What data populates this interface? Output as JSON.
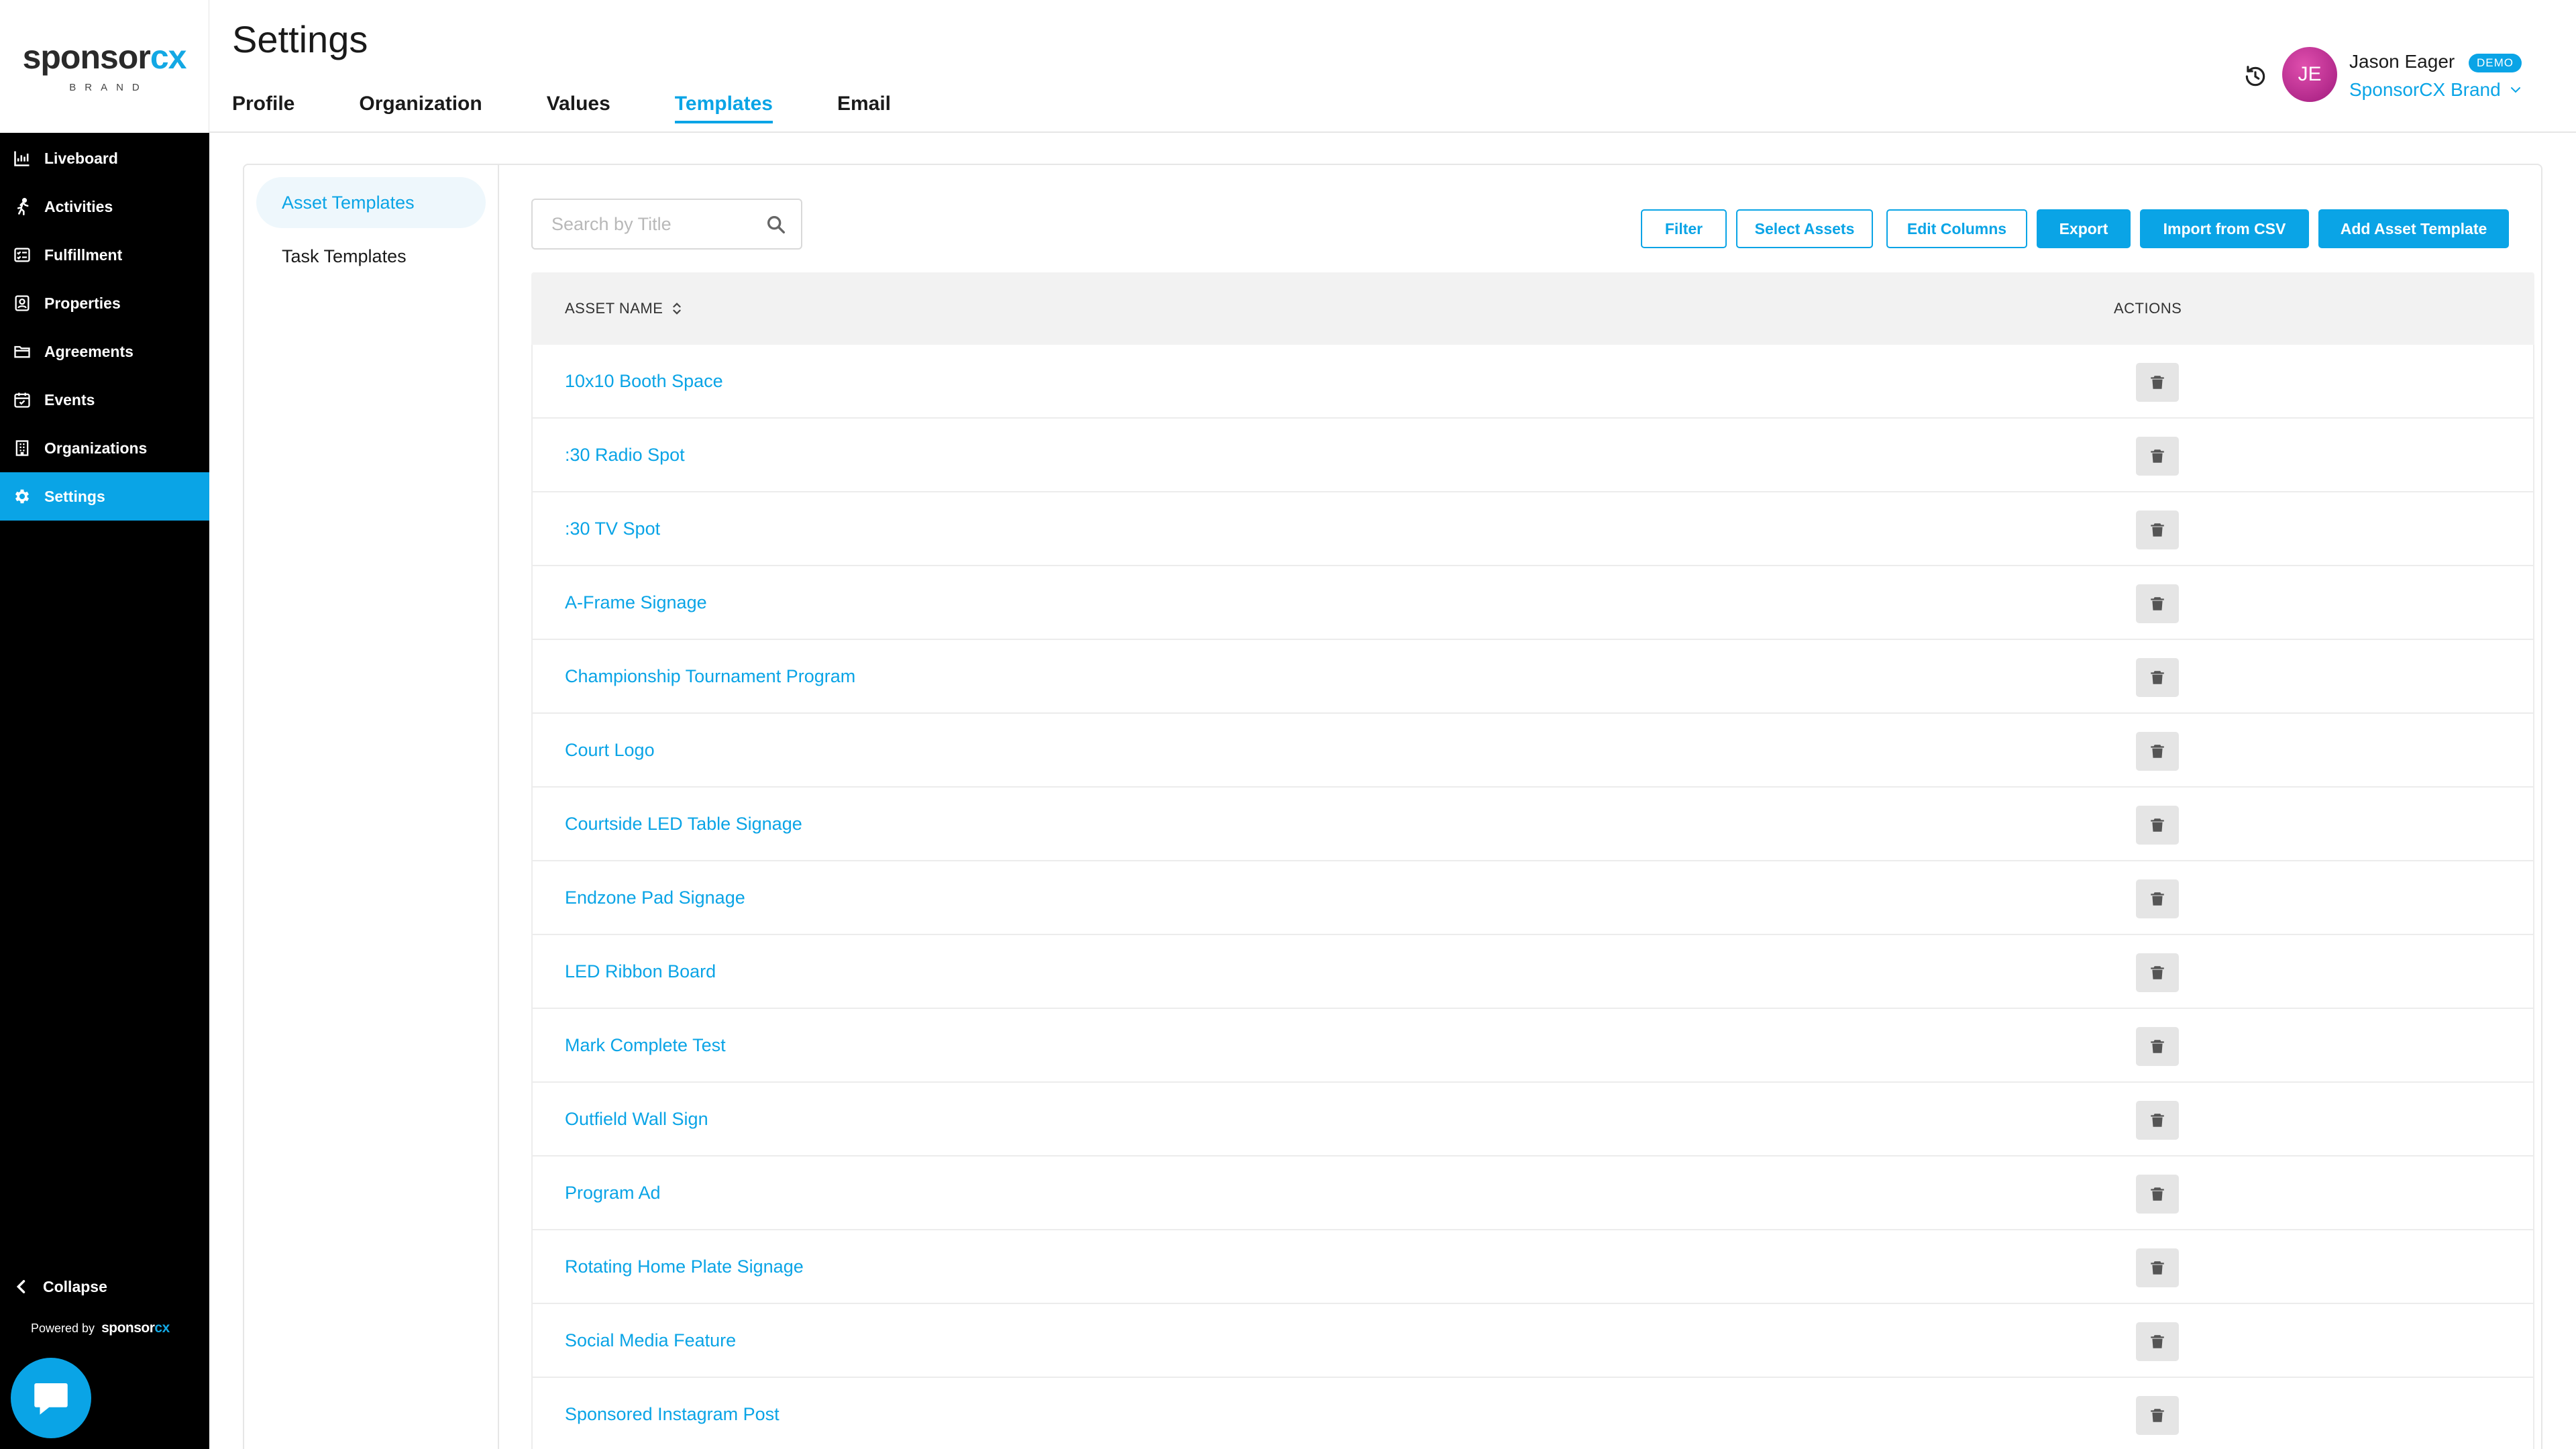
{
  "app": {
    "logo_main": "sponsor",
    "logo_accent": "cx",
    "logo_sub": "BRAND"
  },
  "sidebar": {
    "items": [
      {
        "label": "Liveboard",
        "icon": "chart-icon"
      },
      {
        "label": "Activities",
        "icon": "running-icon"
      },
      {
        "label": "Fulfillment",
        "icon": "checklist-icon"
      },
      {
        "label": "Properties",
        "icon": "id-card-icon"
      },
      {
        "label": "Agreements",
        "icon": "folder-icon"
      },
      {
        "label": "Events",
        "icon": "calendar-check-icon"
      },
      {
        "label": "Organizations",
        "icon": "building-icon"
      },
      {
        "label": "Settings",
        "icon": "gear-icon",
        "active": true
      }
    ],
    "collapse_label": "Collapse",
    "powered_by": "Powered by",
    "powered_logo_main": "sponsor",
    "powered_logo_accent": "cx"
  },
  "header": {
    "title": "Settings",
    "tabs": [
      {
        "label": "Profile"
      },
      {
        "label": "Organization"
      },
      {
        "label": "Values"
      },
      {
        "label": "Templates",
        "active": true
      },
      {
        "label": "Email"
      }
    ],
    "user": {
      "initials": "JE",
      "name": "Jason Eager",
      "badge": "DEMO",
      "org": "SponsorCX Brand"
    }
  },
  "left_menu": {
    "items": [
      {
        "label": "Asset Templates",
        "active": true
      },
      {
        "label": "Task Templates"
      }
    ]
  },
  "toolbar": {
    "search_placeholder": "Search by Title",
    "filter_label": "Filter",
    "select_assets_label": "Select Assets",
    "edit_columns_label": "Edit Columns",
    "export_label": "Export",
    "import_label": "Import from CSV",
    "add_label": "Add Asset Template"
  },
  "table": {
    "col_name": "ASSET NAME",
    "col_actions": "ACTIONS",
    "rows": [
      "10x10 Booth Space",
      ":30 Radio Spot",
      ":30 TV Spot",
      "A-Frame Signage",
      "Championship Tournament Program",
      "Court Logo",
      "Courtside LED Table Signage",
      "Endzone Pad Signage",
      "LED Ribbon Board",
      "Mark Complete Test",
      "Outfield Wall Sign",
      "Program Ad",
      "Rotating Home Plate Signage",
      "Social Media Feature",
      "Sponsored Instagram Post"
    ]
  },
  "colors": {
    "accent": "#0aa4e6",
    "sidebar_bg": "#000000",
    "header_bg": "#f2f2f2",
    "delete_bg": "#e5e5e5"
  }
}
